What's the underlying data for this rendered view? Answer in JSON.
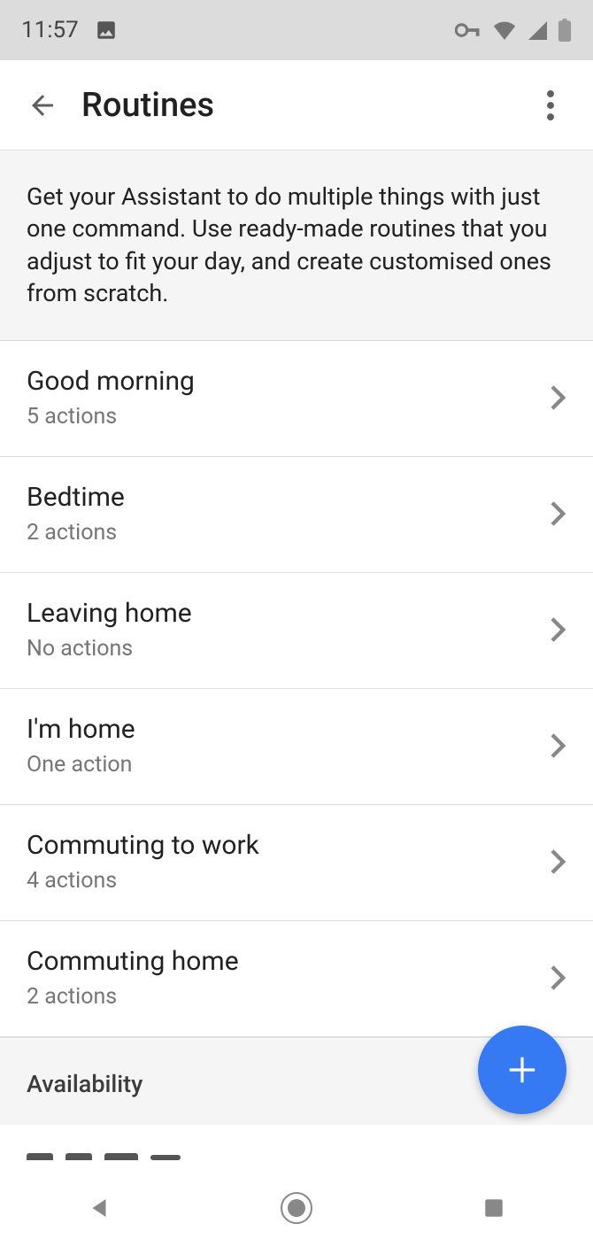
{
  "status": {
    "time": "11:57"
  },
  "header": {
    "title": "Routines"
  },
  "intro": "Get your Assistant to do multiple things with just one command. Use ready-made routines that you adjust to fit your day, and create customised ones from scratch.",
  "routines": [
    {
      "title": "Good morning",
      "subtitle": "5 actions"
    },
    {
      "title": "Bedtime",
      "subtitle": "2 actions"
    },
    {
      "title": "Leaving home",
      "subtitle": "No actions"
    },
    {
      "title": "I'm home",
      "subtitle": "One action"
    },
    {
      "title": "Commuting to work",
      "subtitle": "4 actions"
    },
    {
      "title": "Commuting home",
      "subtitle": "2 actions"
    }
  ],
  "section": {
    "availability": "Availability"
  }
}
